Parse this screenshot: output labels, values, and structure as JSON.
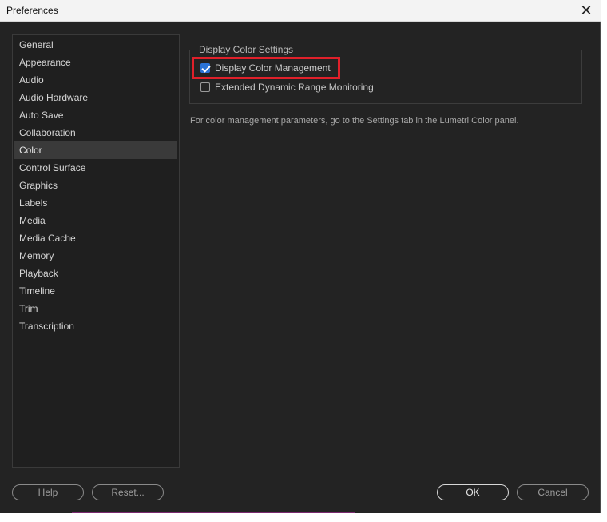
{
  "window": {
    "title": "Preferences",
    "close_glyph": "✕"
  },
  "sidebar": {
    "items": [
      {
        "label": "General"
      },
      {
        "label": "Appearance"
      },
      {
        "label": "Audio"
      },
      {
        "label": "Audio Hardware"
      },
      {
        "label": "Auto Save"
      },
      {
        "label": "Collaboration"
      },
      {
        "label": "Color"
      },
      {
        "label": "Control Surface"
      },
      {
        "label": "Graphics"
      },
      {
        "label": "Labels"
      },
      {
        "label": "Media"
      },
      {
        "label": "Media Cache"
      },
      {
        "label": "Memory"
      },
      {
        "label": "Playback"
      },
      {
        "label": "Timeline"
      },
      {
        "label": "Trim"
      },
      {
        "label": "Transcription"
      }
    ],
    "selected": "Color"
  },
  "color_panel": {
    "group_title": "Display Color Settings",
    "display_color_management": {
      "label": "Display Color Management",
      "checked": true
    },
    "extended_dynamic_range": {
      "label": "Extended Dynamic Range Monitoring",
      "checked": false
    },
    "note": "For color management parameters, go to the Settings tab in the Lumetri Color panel."
  },
  "footer": {
    "help_label": "Help",
    "reset_label": "Reset...",
    "ok_label": "OK",
    "cancel_label": "Cancel"
  },
  "colors": {
    "background": "#232323",
    "accent_checkbox": "#2b73d6",
    "highlight_box": "#e0202a"
  }
}
